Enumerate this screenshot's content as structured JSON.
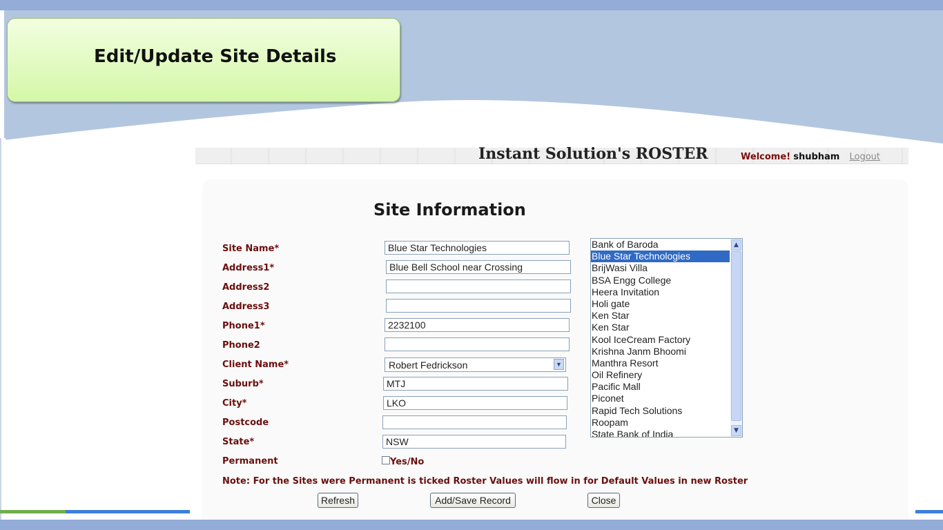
{
  "slide": {
    "title": "Edit/Update Site Details"
  },
  "app": {
    "title": "Instant Solution's ROSTER",
    "welcome_label": "Welcome!",
    "username": "shubham",
    "logout_label": "Logout"
  },
  "form": {
    "heading": "Site Information",
    "fields": {
      "site_name": {
        "label": "Site Name*",
        "value": "Blue Star Technologies"
      },
      "address1": {
        "label": "Address1*",
        "value": "Blue Bell School near Crossing"
      },
      "address2": {
        "label": "Address2",
        "value": ""
      },
      "address3": {
        "label": "Address3",
        "value": ""
      },
      "phone1": {
        "label": "Phone1*",
        "value": "2232100"
      },
      "phone2": {
        "label": "Phone2",
        "value": ""
      },
      "client_name": {
        "label": "Client Name*",
        "value": "Robert Fedrickson"
      },
      "suburb": {
        "label": "Suburb*",
        "value": "MTJ"
      },
      "city": {
        "label": "City*",
        "value": "LKO"
      },
      "postcode": {
        "label": "Postcode",
        "value": ""
      },
      "state": {
        "label": "State*",
        "value": "NSW"
      },
      "permanent": {
        "label": "Permanent",
        "checkbox_text": "Yes/No",
        "checked": false
      }
    },
    "note": "Note: For the Sites were Permanent is ticked Roster Values will flow in for Default Values in new Roster",
    "buttons": {
      "refresh": "Refresh",
      "save": "Add/Save Record",
      "close": "Close"
    }
  },
  "site_list": {
    "selected": "Blue Star Technologies",
    "items": [
      "Bank of Baroda",
      "Blue Star Technologies",
      "BrijWasi Villa",
      "BSA Engg College",
      "Heera Invitation",
      "Holi gate",
      "Ken Star",
      "Ken Star",
      "Kool IceCream Factory",
      "Krishna Janm Bhoomi",
      "Manthra Resort",
      "Oil Refinery",
      "Pacific Mall",
      "Piconet",
      "Rapid Tech Solutions",
      "Roopam",
      "State Bank of India"
    ]
  },
  "colors": {
    "label_color": "#6a0f0f",
    "selection": "#316ac5",
    "title_box_green": "#d4f7a7",
    "frame_blue": "#93acd8"
  }
}
